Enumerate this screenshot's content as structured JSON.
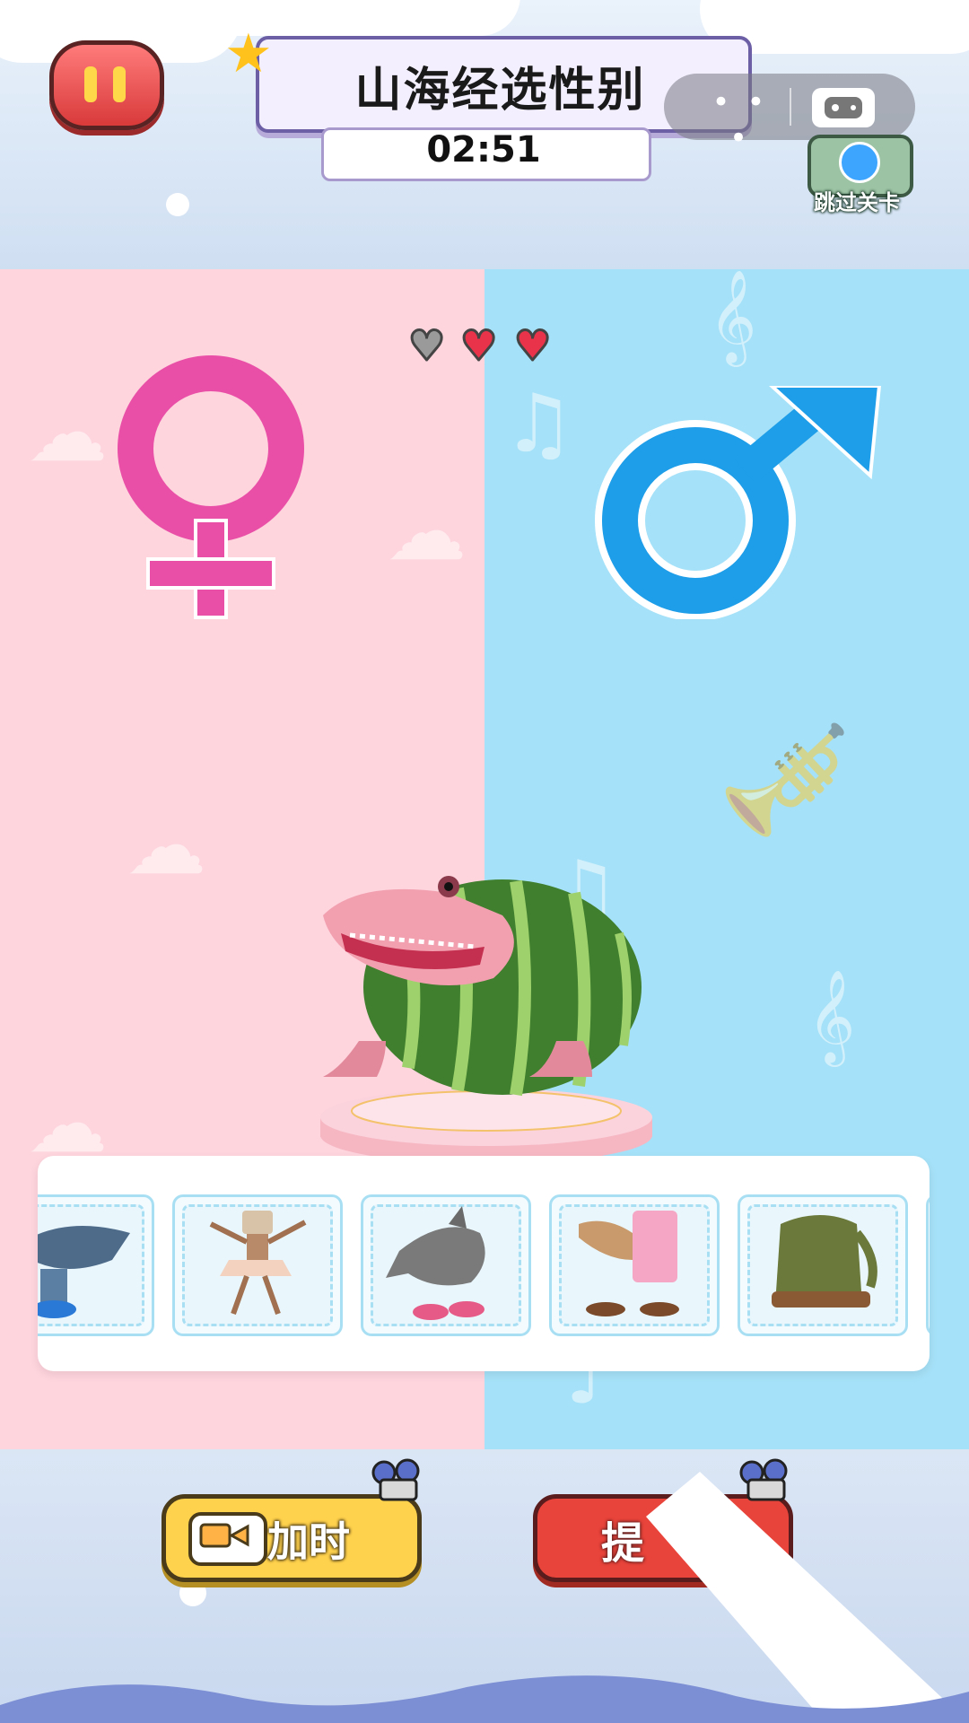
{
  "header": {
    "title": "山海经选性别",
    "timer": "02:51",
    "more_label": "• • •",
    "skip_label": "跳过关卡"
  },
  "lives": {
    "total": 3,
    "remaining": 2
  },
  "gender_options": [
    {
      "symbol": "female",
      "color": "#e94fa7"
    },
    {
      "symbol": "male",
      "color": "#1e9de8"
    }
  ],
  "current_creature": "watermelon-crocodile",
  "tray": {
    "items": [
      "shark-with-sneakers",
      "coffee-cup-ballerina",
      "shark-in-pink-shoes",
      "camel-fridge",
      "elephant-sandals"
    ]
  },
  "buttons": {
    "add_time": "加时",
    "hint": "提"
  },
  "colors": {
    "left_panel": "#fed4dd",
    "right_panel": "#a5e1f8",
    "add_time_bg": "#ffd24d",
    "hint_bg": "#e9443b"
  }
}
